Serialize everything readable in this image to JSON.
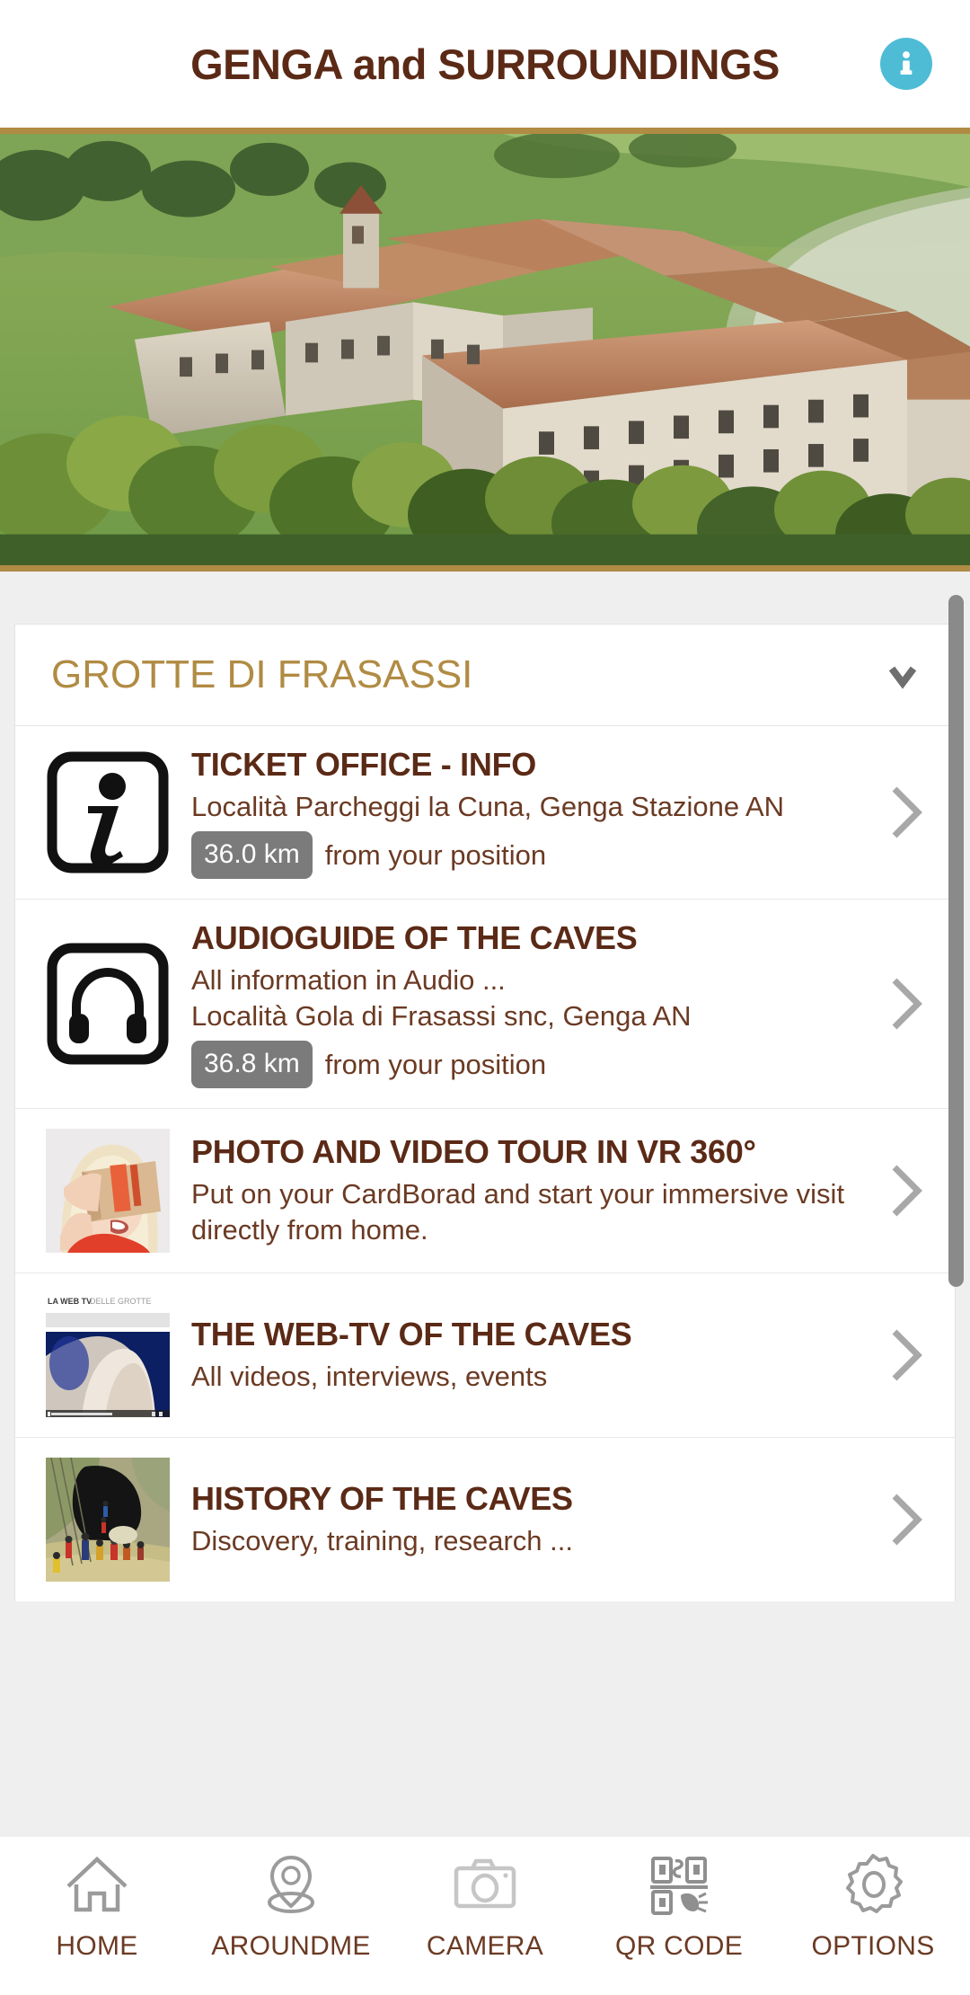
{
  "header": {
    "title": "GENGA and SURROUNDINGS",
    "info_icon": "info-circle-icon",
    "title_color": "#5b2a16",
    "info_color": "#4fbcd6"
  },
  "hero": {
    "alt": "Aerial view of Genga historic village with terracotta roofs",
    "collapse_icon": "chevron-up-icon",
    "border_color": "#b08b43"
  },
  "section": {
    "title": "GROTTE DI FRASASSI",
    "title_color": "#b08b43",
    "toggle_icon": "chevron-down-icon"
  },
  "items": [
    {
      "title": "TICKET OFFICE - INFO",
      "desc": "",
      "address": "Località Parcheggi la Cuna, Genga Stazione AN",
      "distance": "36.0 km",
      "distance_label": "from your position",
      "thumb": "info-letter-icon",
      "arrow": "chevron-right-icon"
    },
    {
      "title": "AUDIOGUIDE OF THE CAVES",
      "desc": "All information in Audio ...",
      "address": "Località Gola di Frasassi snc, Genga AN",
      "distance": "36.8 km",
      "distance_label": "from your position",
      "thumb": "headphones-icon",
      "arrow": "chevron-right-icon"
    },
    {
      "title": "PHOTO AND VIDEO TOUR IN VR 360°",
      "desc": "Put on your CardBorad and start your immersive visit directly from home.",
      "address": "",
      "distance": "",
      "distance_label": "",
      "thumb": "vr-headset-photo",
      "arrow": "chevron-right-icon"
    },
    {
      "title": "THE WEB-TV OF THE CAVES",
      "desc": "All videos, interviews, events",
      "address": "",
      "distance": "",
      "distance_label": "",
      "thumb": "webtv-screenshot",
      "thumb_caption_top": "LA WEB TV DELLE GROTTE",
      "arrow": "chevron-right-icon"
    },
    {
      "title": "HISTORY OF THE CAVES",
      "desc": "Discovery, training, research ...",
      "address": "",
      "distance": "",
      "distance_label": "",
      "thumb": "cave-entrance-photo",
      "arrow": "chevron-right-icon"
    }
  ],
  "tabbar": {
    "items": [
      {
        "label": "HOME",
        "icon": "home-icon"
      },
      {
        "label": "AROUNDME",
        "icon": "map-pin-icon"
      },
      {
        "label": "CAMERA",
        "icon": "camera-icon"
      },
      {
        "label": "QR CODE",
        "icon": "qr-code-icon"
      },
      {
        "label": "OPTIONS",
        "icon": "gear-icon"
      }
    ],
    "label_color": "#6b3a23"
  },
  "scrollbar": {
    "visible": true,
    "color": "#8a8a8a"
  }
}
